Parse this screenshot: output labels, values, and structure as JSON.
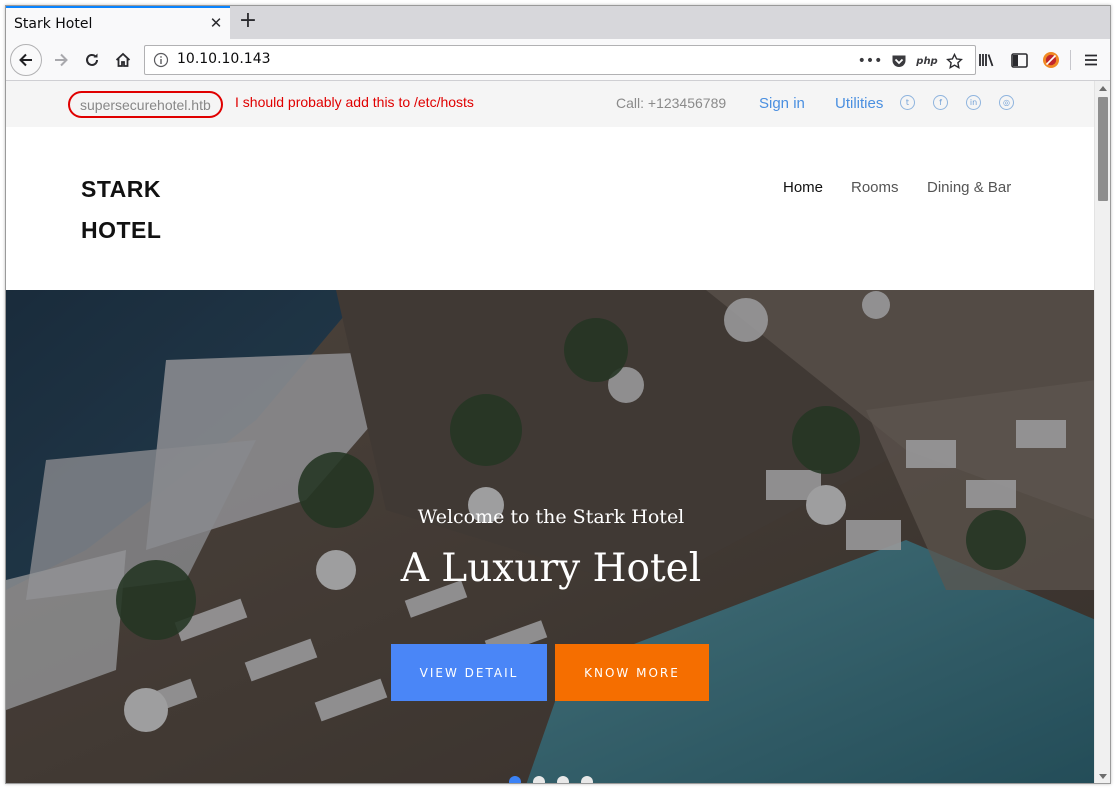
{
  "browser": {
    "tab_title": "Stark Hotel",
    "tab_close": "✕",
    "new_tab": "+",
    "url": "10.10.10.143",
    "page_actions": "•••",
    "php_label": "php"
  },
  "topbar": {
    "domain": "supersecurehotel.htb",
    "note": "I should probably add this to /etc/hosts",
    "call": "Call: +123456789",
    "sign_in": "Sign in",
    "utilities": "Utilities",
    "socials": [
      "twitter-icon",
      "facebook-icon",
      "linkedin-icon",
      "dribbble-icon"
    ]
  },
  "header": {
    "logo_line1": "STARK",
    "logo_line2": "HOTEL",
    "menu": [
      "Home",
      "Rooms",
      "Dining & Bar"
    ]
  },
  "hero": {
    "subtitle": "Welcome to the Stark Hotel",
    "title": "A Luxury Hotel",
    "button_detail": "VIEW DETAIL",
    "button_more": "KNOW MORE",
    "slides": 4,
    "active_slide": 1
  },
  "colors": {
    "annotation_red": "#e00000",
    "link_blue": "#4a8fe0",
    "button_blue": "#4a86f7",
    "button_orange": "#f56e00",
    "firefox_accent": "#0a84ff"
  }
}
